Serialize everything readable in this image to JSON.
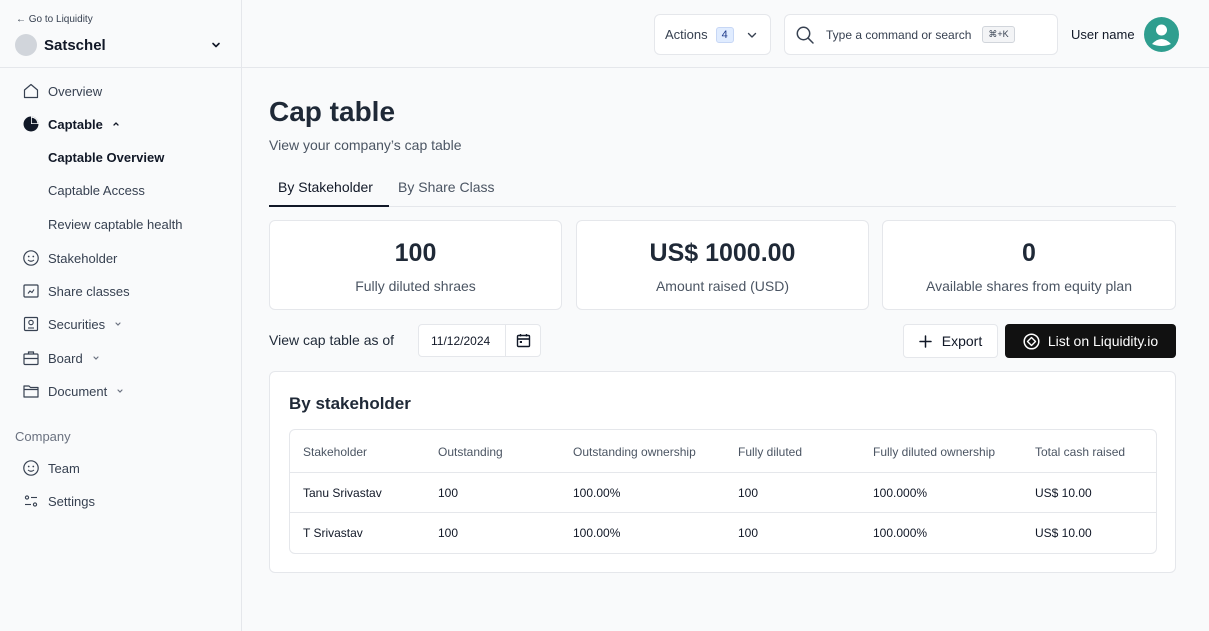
{
  "sidebar": {
    "back_link": "← Go to Liquidity",
    "company_name": "Satschel",
    "nav": {
      "overview": "Overview",
      "captable": "Captable",
      "captable_overview": "Captable Overview",
      "captable_access": "Captable Access",
      "review_health": "Review captable health",
      "stakeholder": "Stakeholder",
      "share_classes": "Share classes",
      "securities": "Securities",
      "board": "Board",
      "document": "Document"
    },
    "company_section": "Company",
    "team": "Team",
    "settings": "Settings"
  },
  "topbar": {
    "actions_label": "Actions",
    "actions_count": "4",
    "search_placeholder": "Type a command or search",
    "shortcut": "⌘+K",
    "user_name": "User name",
    "accent_color": "#2f9e8f"
  },
  "page": {
    "title": "Cap table",
    "subtitle": "View your company’s cap table"
  },
  "tabs": {
    "by_stakeholder": "By Stakeholder",
    "by_share_class": "By Share Class"
  },
  "stats": [
    {
      "value": "100",
      "label": "Fully diluted shraes"
    },
    {
      "value": "US$ 1000.00",
      "label": "Amount raised (USD)"
    },
    {
      "value": "0",
      "label": "Available shares from equity plan"
    }
  ],
  "toolbar": {
    "asof_label": "View cap table as of",
    "date": "11/12/2024",
    "export_label": "Export",
    "list_label": "List on Liquidity.io"
  },
  "table": {
    "title": "By stakeholder",
    "headers": [
      "Stakeholder",
      "Outstanding",
      "Outstanding ownership",
      "Fully diluted",
      "Fully diluted ownership",
      "Total cash raised"
    ],
    "rows": [
      [
        "Tanu Srivastav",
        "100",
        "100.00%",
        "100",
        "100.000%",
        "US$ 10.00"
      ],
      [
        "T Srivastav",
        "100",
        "100.00%",
        "100",
        "100.000%",
        "US$ 10.00"
      ]
    ]
  }
}
